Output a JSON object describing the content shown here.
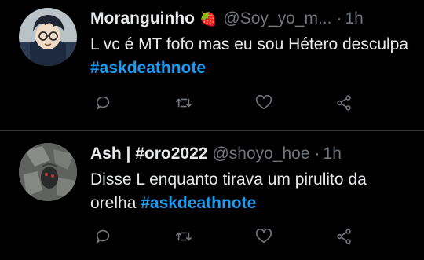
{
  "tweets": [
    {
      "display_name": "Moranguinho",
      "badge": "🍓",
      "handle": "@Soy_yo_m...",
      "separator": "·",
      "time": "1h",
      "text_parts": [
        "L vc é MT fofo mas eu sou Hétero desculpa "
      ],
      "hashtag": "#askdeathnote"
    },
    {
      "display_name": "Ash | #oro2022",
      "handle": "@shoyo_hoe",
      "separator": "·",
      "time": "1h",
      "text_parts": [
        "Disse L enquanto tirava um pirulito da orelha "
      ],
      "hashtag": "#askdeathnote"
    }
  ],
  "icons": {
    "reply": "reply-icon",
    "retweet": "retweet-icon",
    "like": "heart-icon",
    "share": "share-icon"
  },
  "colors": {
    "background": "#000000",
    "text": "#e7e9ea",
    "muted": "#71767b",
    "hashtag": "#1d9bf0",
    "divider": "#2f3336"
  }
}
